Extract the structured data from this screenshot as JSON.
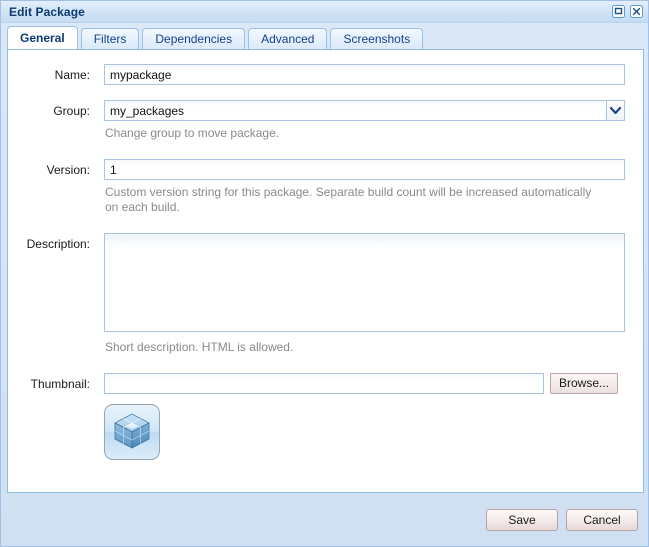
{
  "window": {
    "title": "Edit Package",
    "controls": [
      {
        "name": "maximize-button",
        "icon": "maximize-icon"
      },
      {
        "name": "close-button",
        "icon": "close-icon"
      }
    ]
  },
  "tabs": [
    {
      "label": "General",
      "active": true
    },
    {
      "label": "Filters",
      "active": false
    },
    {
      "label": "Dependencies",
      "active": false
    },
    {
      "label": "Advanced",
      "active": false
    },
    {
      "label": "Screenshots",
      "active": false
    }
  ],
  "form": {
    "name": {
      "label": "Name:",
      "value": "mypackage",
      "placeholder": ""
    },
    "group": {
      "label": "Group:",
      "value": "my_packages",
      "placeholder": "",
      "hint": "Change group to move package.",
      "options": [
        "my_packages"
      ]
    },
    "version": {
      "label": "Version:",
      "value": "1",
      "placeholder": "",
      "hint": "Custom version string for this package. Separate build count will be increased automatically on each build."
    },
    "description": {
      "label": "Description:",
      "value": "",
      "placeholder": "",
      "hint": "Short description. HTML is allowed."
    },
    "thumbnail": {
      "label": "Thumbnail:",
      "value": "",
      "placeholder": "",
      "browse_label": "Browse...",
      "preview_icon": "package-cube-icon"
    }
  },
  "footer": {
    "save_label": "Save",
    "cancel_label": "Cancel"
  },
  "colors": {
    "title_text": "#0d3a73",
    "accent": "#15428b",
    "window_bg": "#cfe0f0",
    "panel_bg": "#ffffff",
    "hint_text": "#8a8a8a",
    "field_border": "#a8c4e0"
  }
}
